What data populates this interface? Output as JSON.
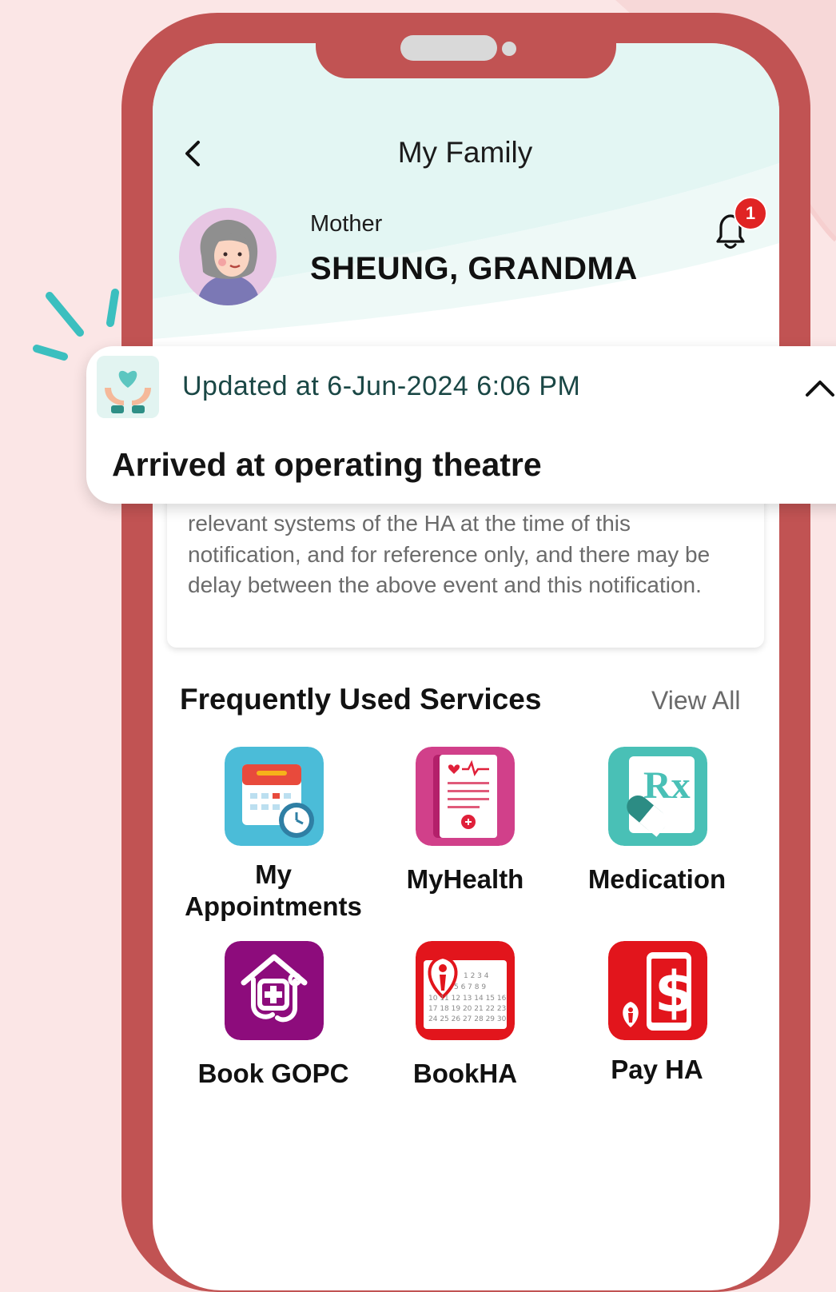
{
  "header": {
    "title": "My Family"
  },
  "member": {
    "relation": "Mother",
    "name": "SHEUNG, GRANDMA"
  },
  "notifications": {
    "badge_count": "1"
  },
  "popup": {
    "updated_text": "Updated at 6-Jun-2024 6:06 PM",
    "status": "Arrived at operating theatre"
  },
  "notice": {
    "text": "relevant systems of the HA at the time of this notification, and for reference only, and there may be delay between the above event and this notification."
  },
  "services": {
    "title": "Frequently Used Services",
    "view_all": "View All",
    "items": [
      {
        "label": "My Appointments",
        "icon": "calendar-clock-icon"
      },
      {
        "label": "MyHealth",
        "icon": "health-record-icon"
      },
      {
        "label": "Medication",
        "icon": "prescription-icon"
      },
      {
        "label": "Book GOPC",
        "icon": "house-stethoscope-icon"
      },
      {
        "label": "BookHA",
        "icon": "ha-calendar-icon"
      },
      {
        "label": "Pay HA",
        "icon": "ha-payment-icon"
      }
    ]
  },
  "colors": {
    "frame": "#c15353",
    "background": "#fbe6e6",
    "header_tint": "#e3f6f3",
    "accent_teal": "#3bbfbf",
    "badge": "#e02424",
    "bookgopc": "#8d0c7c",
    "ha_red": "#e2151c"
  }
}
